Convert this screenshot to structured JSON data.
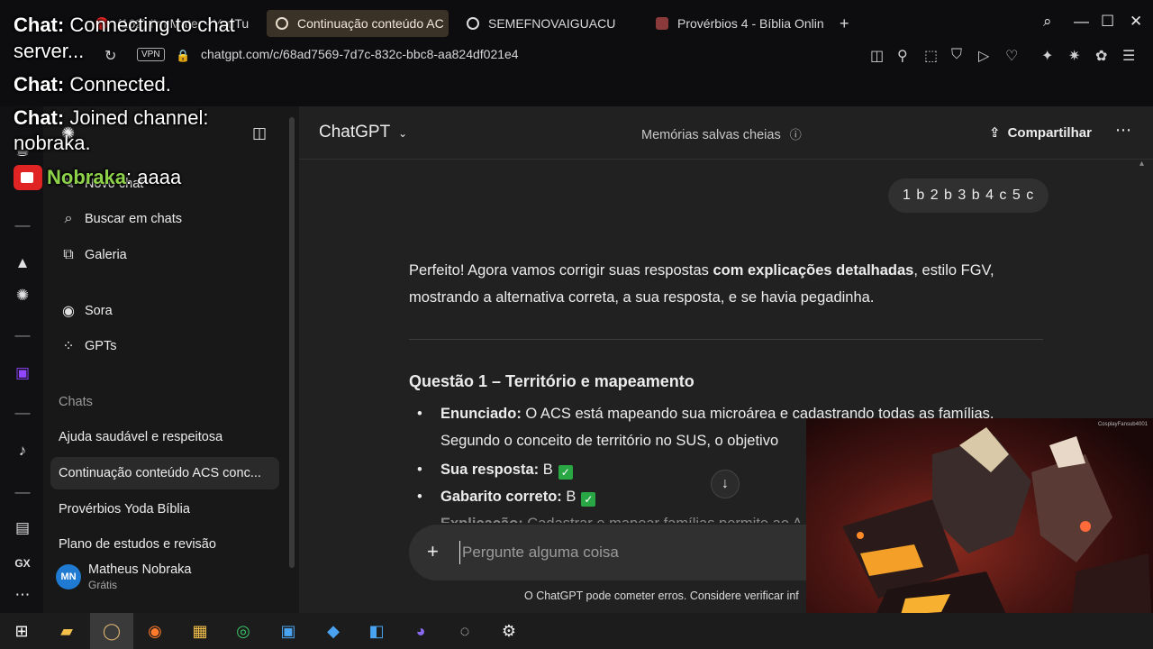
{
  "browser": {
    "tabs": [
      {
        "label": "(162) I'm Mater - YouTu"
      },
      {
        "label": "Continuação conteúdo AC"
      },
      {
        "label": "SEMEFNOVAIGUACU"
      },
      {
        "label": "Provérbios 4 - Bíblia Onlin"
      }
    ],
    "new_tab": "+",
    "vpn": "VPN",
    "url": "chatgpt.com/c/68ad7569-7d7c-832c-bbc8-aa824df021e4"
  },
  "sidebar": {
    "items": [
      {
        "label": "Novo chat"
      },
      {
        "label": "Buscar em chats"
      },
      {
        "label": "Galeria"
      },
      {
        "label": "Sora"
      },
      {
        "label": "GPTs"
      }
    ],
    "section": "Chats",
    "chats": [
      {
        "label": "Ajuda saudável e respeitosa"
      },
      {
        "label": "Continuação conteúdo ACS conc..."
      },
      {
        "label": "Provérbios Yoda Bíblia"
      },
      {
        "label": "Plano de estudos e revisão"
      }
    ],
    "user": {
      "initials": "MN",
      "name": "Matheus Nobraka",
      "plan": "Grátis"
    }
  },
  "main": {
    "title": "ChatGPT",
    "memory": "Memórias salvas cheias",
    "share": "Compartilhar",
    "user_message": "1 b 2 b 3 b 4 c 5 c",
    "reply": {
      "p1": "Perfeito! Agora vamos corrigir suas respostas ",
      "p1_bold": "com explicações detalhadas",
      "p1_end": ", estilo FGV,",
      "p2": "mostrando a alternativa correta, a sua resposta, e se havia pegadinha."
    },
    "question_title": "Questão 1 – Território e mapeamento",
    "bullets": {
      "enunciado_label": "Enunciado:",
      "enunciado_text": " O ACS está mapeando sua microárea e cadastrando todas as famílias.",
      "enunciado_cont": "Segundo o conceito de território no SUS, o objetivo",
      "resposta_label": "Sua resposta:",
      "resposta_text": " B",
      "gabarito_label": "Gabarito correto:",
      "gabarito_text": " B",
      "explicacao_label": "Explicação:",
      "explicacao_text": " Cadastrar e mapear famílias permite ao A"
    },
    "composer_placeholder": "Pergunte alguma coisa",
    "footer": "O ChatGPT pode cometer erros. Considere verificar inf"
  },
  "overlay": {
    "line1_label": "Chat:",
    "line1_text": " Connecting to chat",
    "line1_cont": "server...",
    "line2_label": "Chat:",
    "line2_text": " Connected.",
    "line3_label": "Chat:",
    "line3_text": " Joined channel:",
    "line3_cont": "nobraka.",
    "line4_nick": "Nobraka",
    "line4_text": ": aaaa"
  },
  "video": {
    "tag": "CosplayFansub4001"
  },
  "colors": {
    "accent_tab": "#3b3227",
    "avatar": "#1f7ad1",
    "check": "#2aa745",
    "nick": "#8ed24a"
  }
}
